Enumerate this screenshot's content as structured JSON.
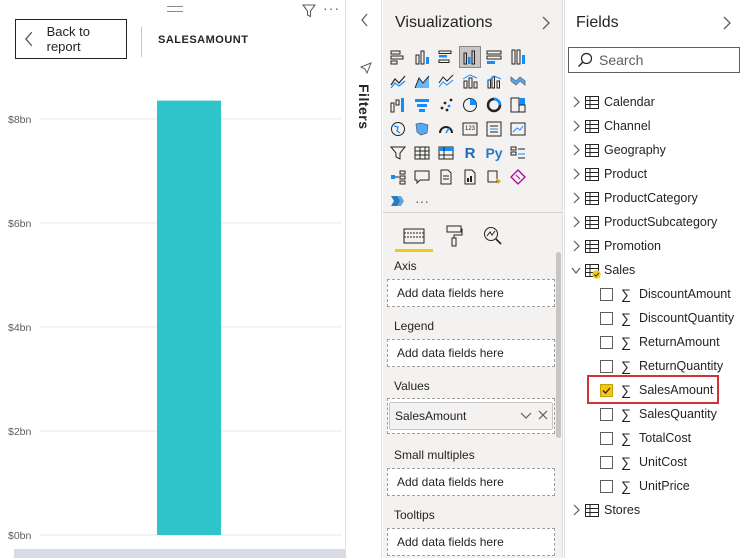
{
  "report": {
    "back_label": "Back to report",
    "chart_title": "SALESAMOUNT",
    "more_label": "···"
  },
  "chart_data": {
    "type": "bar",
    "title": "SALESAMOUNT",
    "categories": [
      ""
    ],
    "values": [
      8.35
    ],
    "value_unit": "bn",
    "y_ticks": [
      "$0bn",
      "$2bn",
      "$4bn",
      "$6bn",
      "$8bn"
    ],
    "y_tick_values": [
      0,
      2,
      4,
      6,
      8
    ],
    "ylim": [
      0,
      8.9
    ],
    "bar_color": "#2ec4c9",
    "grid": true
  },
  "filters": {
    "label": "Filters"
  },
  "visualizations": {
    "title": "Visualizations",
    "more_label": "···",
    "wells": {
      "axis_label": "Axis",
      "axis_placeholder": "Add data fields here",
      "legend_label": "Legend",
      "legend_placeholder": "Add data fields here",
      "values_label": "Values",
      "values_field": "SalesAmount",
      "small_multiples_label": "Small multiples",
      "small_multiples_placeholder": "Add data fields here",
      "tooltips_label": "Tooltips",
      "tooltips_placeholder": "Add data fields here"
    },
    "r_label": "R",
    "py_label": "Py",
    "num_label": "123"
  },
  "fields": {
    "title": "Fields",
    "search_placeholder": "Search",
    "tables": [
      {
        "name": "Calendar"
      },
      {
        "name": "Channel"
      },
      {
        "name": "Geography"
      },
      {
        "name": "Product"
      },
      {
        "name": "ProductCategory"
      },
      {
        "name": "ProductSubcategory"
      },
      {
        "name": "Promotion"
      },
      {
        "name": "Sales"
      }
    ],
    "sales_fields": [
      {
        "name": "DiscountAmount",
        "checked": false
      },
      {
        "name": "DiscountQuantity",
        "checked": false
      },
      {
        "name": "ReturnAmount",
        "checked": false
      },
      {
        "name": "ReturnQuantity",
        "checked": false
      },
      {
        "name": "SalesAmount",
        "checked": true
      },
      {
        "name": "SalesQuantity",
        "checked": false
      },
      {
        "name": "TotalCost",
        "checked": false
      },
      {
        "name": "UnitCost",
        "checked": false
      },
      {
        "name": "UnitPrice",
        "checked": false
      }
    ],
    "last_table": "Stores"
  },
  "colors": {
    "accent_yellow": "#f2c811",
    "highlight_red": "#d13438",
    "bar_teal": "#2ec4c9"
  }
}
